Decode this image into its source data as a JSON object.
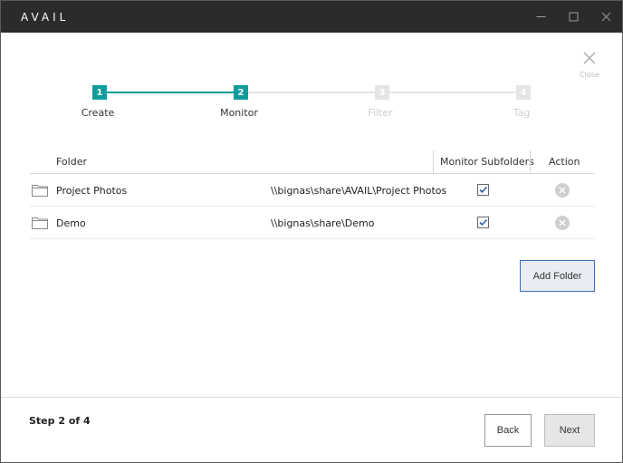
{
  "window": {
    "title": "AVAIL",
    "controls": {
      "minimize_icon": "minimize-icon",
      "maximize_icon": "maximize-icon",
      "close_icon": "close-icon"
    }
  },
  "close_panel": {
    "label": "Close"
  },
  "stepper": {
    "steps": [
      {
        "number": "1",
        "label": "Create",
        "state": "done"
      },
      {
        "number": "2",
        "label": "Monitor",
        "state": "current"
      },
      {
        "number": "3",
        "label": "Filter",
        "state": "pending"
      },
      {
        "number": "4",
        "label": "Tag",
        "state": "pending"
      }
    ],
    "colors": {
      "active": "#109c9c",
      "inactive": "#e5e5e5"
    }
  },
  "table": {
    "headers": {
      "folder": "Folder",
      "monitor_subfolders": "Monitor Subfolders",
      "action": "Action"
    },
    "rows": [
      {
        "name": "Project Photos",
        "path": "\\\\bignas\\share\\AVAIL\\Project Photos",
        "monitor_subfolders": true
      },
      {
        "name": "Demo",
        "path": "\\\\bignas\\share\\Demo",
        "monitor_subfolders": true
      }
    ]
  },
  "actions": {
    "add_folder_label": "Add Folder"
  },
  "footer": {
    "step_text": "Step 2 of 4",
    "back_label": "Back",
    "next_label": "Next"
  }
}
